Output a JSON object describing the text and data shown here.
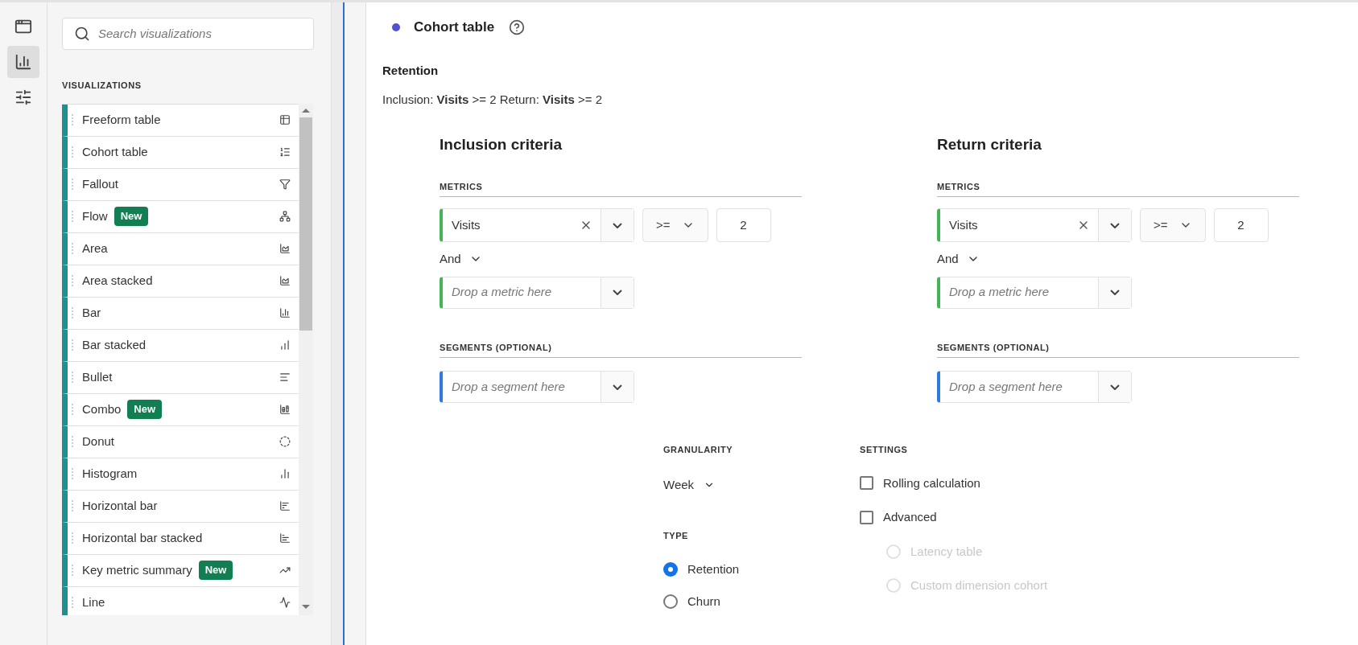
{
  "rail": [
    {
      "selected": false
    },
    {
      "selected": true
    },
    {
      "selected": false
    }
  ],
  "sidebar": {
    "search": {
      "placeholder": "Search visualizations"
    },
    "heading": "VISUALIZATIONS",
    "items": [
      {
        "label": "Freeform table"
      },
      {
        "label": "Cohort table"
      },
      {
        "label": "Fallout"
      },
      {
        "label": "Flow",
        "badge": "New"
      },
      {
        "label": "Area"
      },
      {
        "label": "Area stacked"
      },
      {
        "label": "Bar"
      },
      {
        "label": "Bar stacked"
      },
      {
        "label": "Bullet"
      },
      {
        "label": "Combo",
        "badge": "New"
      },
      {
        "label": "Donut"
      },
      {
        "label": "Histogram"
      },
      {
        "label": "Horizontal bar"
      },
      {
        "label": "Horizontal bar stacked"
      },
      {
        "label": "Key metric summary",
        "badge": "New"
      },
      {
        "label": "Line"
      }
    ]
  },
  "panel": {
    "title": "Cohort table",
    "subtitle": "Retention",
    "summary": "Inclusion: **Visits** >= 2  Return: **Visits** >= 2",
    "criteria": [
      {
        "title": "Inclusion criteria",
        "metrics_heading": "METRICS",
        "metric": {
          "value": "Visits",
          "operator": ">=",
          "threshold": "2"
        },
        "conjunction": "And",
        "metric_placeholder": "Drop a metric here",
        "segments_heading": "SEGMENTS (OPTIONAL)",
        "segment_placeholder": "Drop a segment here"
      },
      {
        "title": "Return criteria",
        "metrics_heading": "METRICS",
        "metric": {
          "value": "Visits",
          "operator": ">=",
          "threshold": "2"
        },
        "conjunction": "And",
        "metric_placeholder": "Drop a metric here",
        "segments_heading": "SEGMENTS (OPTIONAL)",
        "segment_placeholder": "Drop a segment here"
      }
    ],
    "granularity": {
      "heading": "GRANULARITY",
      "value": "Week"
    },
    "type": {
      "heading": "TYPE",
      "options": [
        {
          "label": "Retention",
          "selected": true
        },
        {
          "label": "Churn",
          "selected": false
        }
      ]
    },
    "settings": {
      "heading": "SETTINGS",
      "checkboxes": [
        {
          "label": "Rolling calculation",
          "checked": false
        },
        {
          "label": "Advanced",
          "checked": false
        }
      ],
      "advanced_options": [
        {
          "label": "Latency table",
          "selected": false,
          "disabled": true
        },
        {
          "label": "Custom dimension cohort",
          "selected": false,
          "disabled": true
        }
      ]
    }
  }
}
